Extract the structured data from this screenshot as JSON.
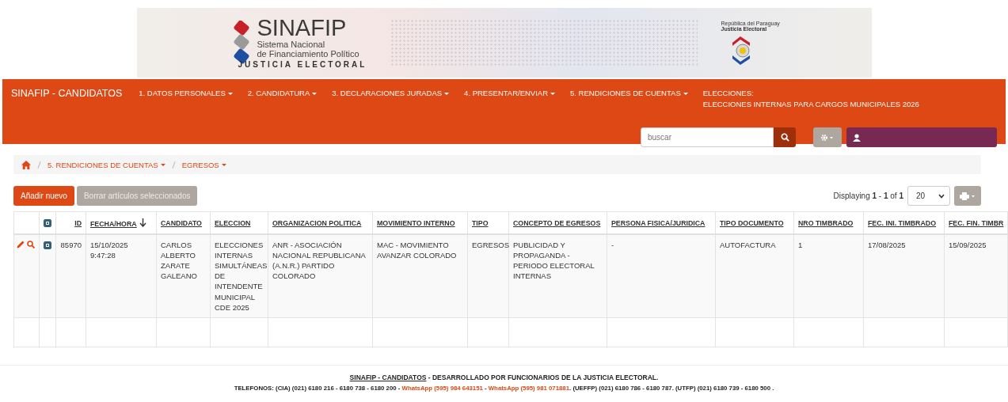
{
  "banner": {
    "title": "SINAFIP",
    "subtitle_lines": [
      "Sistema Nacional",
      "de Financiamiento Político"
    ],
    "org": "JUSTICIA ELECTORAL",
    "emblem_caption": [
      "República del Paraguay",
      "Justicia Electoral"
    ]
  },
  "navbar": {
    "brand": "SINAFIP - CANDIDATOS",
    "menus": [
      {
        "label": "1. DATOS PERSONALES",
        "dropdown": true
      },
      {
        "label": "2. CANDIDATURA",
        "dropdown": true
      },
      {
        "label": "3. DECLARACIONES JURADAS",
        "dropdown": true
      },
      {
        "label": "4. PRESENTAR/ENVIAR",
        "dropdown": true
      },
      {
        "label": "5. RENDICIONES DE CUENTAS",
        "dropdown": true
      }
    ],
    "election_label": "ELECCIONES:",
    "election_name": "ELECCIONES INTERNAS PARA CARGOS MUNICIPALES 2026",
    "search": {
      "placeholder": "buscar"
    }
  },
  "breadcrumb": [
    {
      "label": "5. RENDICIONES DE CUENTAS",
      "dropdown": true
    },
    {
      "label": "EGRESOS",
      "dropdown": true
    }
  ],
  "actions": [
    {
      "label": "Añadir nuevo",
      "disabled": false
    },
    {
      "label": "Borrar artículos seleccionados",
      "disabled": true
    }
  ],
  "pagination": {
    "summary": "Displaying **1** - **1** of **1**",
    "page_size": "20"
  },
  "table": {
    "select_all_checked": true,
    "columns": [
      {
        "label": "ID",
        "sorted": false
      },
      {
        "label": "FECHA/HORA",
        "sorted": true
      },
      {
        "label": "CANDIDATO",
        "sorted": false
      },
      {
        "label": "ELECCION",
        "sorted": false
      },
      {
        "label": "ORGANIZACION POLITICA",
        "sorted": false
      },
      {
        "label": "MOVIMIENTO INTERNO",
        "sorted": false
      },
      {
        "label": "TIPO",
        "sorted": false
      },
      {
        "label": "CONCEPTO DE EGRESOS",
        "sorted": false
      },
      {
        "label": "PERSONA FISICA/JURIDICA",
        "sorted": false
      },
      {
        "label": "TIPO DOCUMENTO",
        "sorted": false
      },
      {
        "label": "NRO TIMBRADO",
        "sorted": false
      },
      {
        "label": "FEC. INI. TIMBRADO",
        "sorted": false
      },
      {
        "label": "FEC. FIN. TIMBR",
        "sorted": false
      }
    ],
    "rows": [
      {
        "checked": true,
        "cells": [
          "85970",
          "15/10/2025 9:47:28",
          "CARLOS ALBERTO ZARATE GALEANO",
          "ELECCIONES INTERNAS SIMULTÁNEAS DE INTENDENTE MUNICIPAL CDE 2025",
          "ANR - ASOCIACIÓN NACIONAL REPUBLICANA (A.N.R.) PARTIDO COLORADO",
          "MAC - MOVIMIENTO AVANZAR COLORADO",
          "EGRESOS",
          "PUBLICIDAD Y PROPAGANDA - PERIODO ELECTORAL INTERNAS",
          "-",
          "AUTOFACTURA",
          "1",
          "17/08/2025",
          "15/09/2025"
        ]
      }
    ]
  },
  "footer": {
    "line1": [
      {
        "text": "SINAFIP - CANDIDATOS",
        "kind": "link"
      },
      {
        "text": " - DESARROLLADO POR FUNCIONARIOS DE LA JUSTICIA ELECTORAL.",
        "kind": "text"
      }
    ],
    "line2": [
      {
        "text": "TELEFONOS: (CIA) (021) 6180 216 - 6180 738 - 6180 200 - ",
        "kind": "text"
      },
      {
        "text": "WhatsApp (595) 984 643151",
        "kind": "whatsapp"
      },
      {
        "text": " - ",
        "kind": "text"
      },
      {
        "text": "WhatsApp (595) 981 071881",
        "kind": "whatsapp"
      },
      {
        "text": ". (UEFFP) (021) 6180 786 - 6180 787. (UTFP) (021) 6180 739 - 6180 500 .",
        "kind": "text"
      }
    ]
  }
}
